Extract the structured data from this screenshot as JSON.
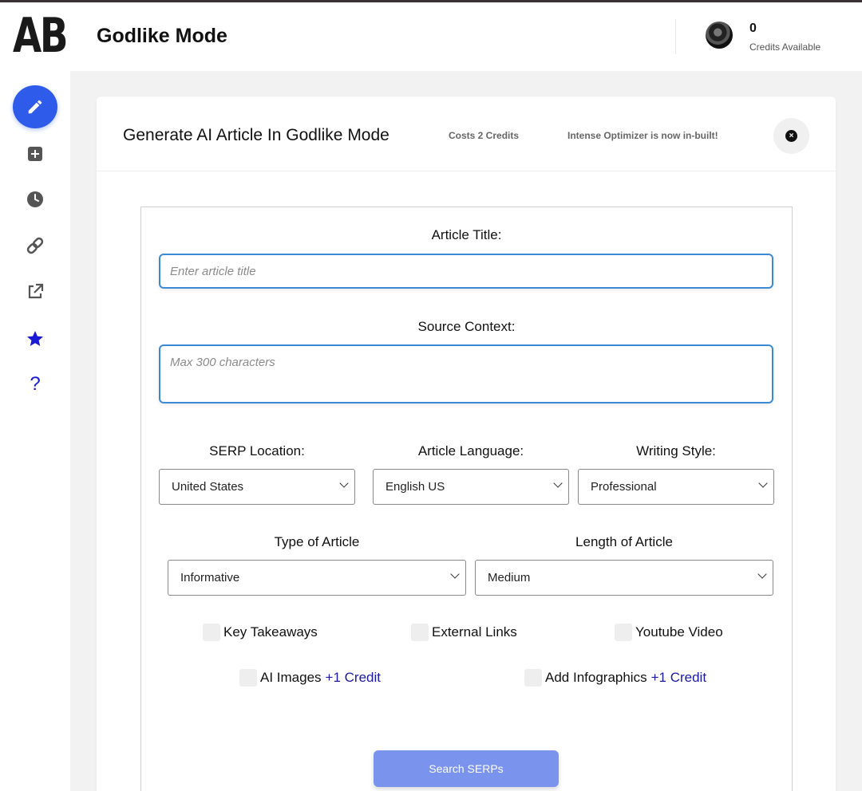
{
  "app": {
    "logo_text": "AB",
    "title": "Godlike Mode",
    "credits_count": "0",
    "credits_label": "Credits Available"
  },
  "sidebar": {
    "items": [
      {
        "icon": "pencil-icon",
        "active": true
      },
      {
        "icon": "plus-square-icon"
      },
      {
        "icon": "clock-icon"
      },
      {
        "icon": "link-icon"
      },
      {
        "icon": "external-link-icon"
      },
      {
        "icon": "star-icon"
      },
      {
        "icon": "question-icon"
      }
    ]
  },
  "card": {
    "title": "Generate AI Article In Godlike Mode",
    "cost": "Costs 2 Credits",
    "note": "Intense Optimizer is now in-built!"
  },
  "form": {
    "article_title_label": "Article Title:",
    "article_title_placeholder": "Enter article title",
    "source_context_label": "Source Context:",
    "source_context_placeholder": "Max 300 characters",
    "serp_location_label": "SERP Location:",
    "serp_location_value": "United States",
    "article_language_label": "Article Language:",
    "article_language_value": "English US",
    "writing_style_label": "Writing Style:",
    "writing_style_value": "Professional",
    "article_type_label": "Type of Article",
    "article_type_value": "Informative",
    "article_length_label": "Length of Article",
    "article_length_value": "Medium",
    "options": {
      "key_takeaways": "Key Takeaways",
      "external_links": "External Links",
      "youtube_video": "Youtube Video",
      "ai_images": "AI Images",
      "ai_images_extra": "+1 Credit",
      "infographics": "Add Infographics",
      "infographics_extra": "+1 Credit"
    },
    "submit_label": "Search SERPs"
  },
  "colors": {
    "accent": "#2f5bea",
    "button": "#7a93ed",
    "link_credit": "#1a1aa6",
    "input_border": "#3a8ad6",
    "star": "#1a1ad6"
  }
}
